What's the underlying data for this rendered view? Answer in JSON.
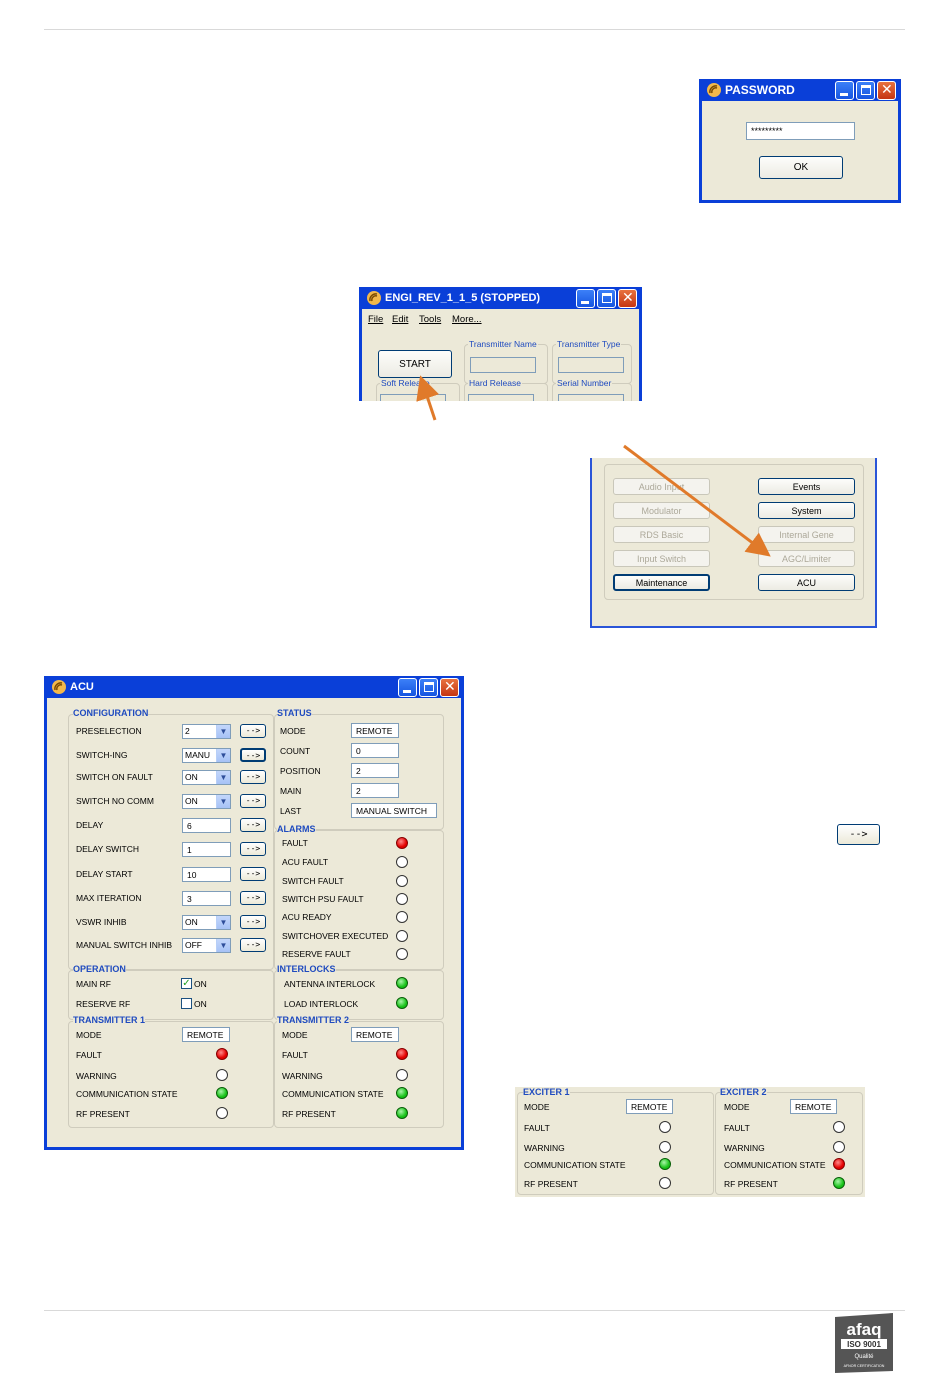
{
  "password_window": {
    "title": "PASSWORD",
    "password_value": "*********",
    "ok_label": "OK"
  },
  "engi_window": {
    "title": "ENGI_REV_1_1_5 (STOPPED)",
    "menu": [
      "File",
      "Edit",
      "Tools",
      "More..."
    ],
    "start_label": "START",
    "fields": [
      "Transmitter Name",
      "Transmitter Type",
      "Soft Release",
      "Hard Release",
      "Serial Number"
    ]
  },
  "panel": {
    "buttons_left": [
      "Audio Input",
      "Modulator",
      "RDS Basic",
      "Input Switch",
      "Maintenance"
    ],
    "buttons_right": [
      "Events",
      "System",
      "Internal Gene",
      "AGC/Limiter",
      "ACU"
    ],
    "enabled_left": [
      false,
      false,
      false,
      false,
      true
    ],
    "enabled_right": [
      true,
      true,
      false,
      false,
      true
    ]
  },
  "acu_window": {
    "title": "ACU",
    "configuration": {
      "title": "CONFIGURATION",
      "rows": [
        {
          "label": "PRESELECTION",
          "value": "2",
          "type": "select"
        },
        {
          "label": "SWITCH-ING",
          "value": "MANU",
          "type": "select"
        },
        {
          "label": "SWITCH ON FAULT",
          "value": "ON",
          "type": "select"
        },
        {
          "label": "SWITCH NO COMM",
          "value": "ON",
          "type": "select"
        },
        {
          "label": "DELAY",
          "value": "6",
          "type": "input"
        },
        {
          "label": "DELAY SWITCH",
          "value": "1",
          "type": "input"
        },
        {
          "label": "DELAY START",
          "value": "10",
          "type": "input"
        },
        {
          "label": "MAX ITERATION",
          "value": "3",
          "type": "input"
        },
        {
          "label": "VSWR INHIB",
          "value": "ON",
          "type": "select"
        },
        {
          "label": "MANUAL SWITCH INHIB",
          "value": "OFF",
          "type": "select"
        }
      ],
      "go_label": "-->"
    },
    "status": {
      "title": "STATUS",
      "rows": [
        {
          "label": "MODE",
          "value": "REMOTE"
        },
        {
          "label": "COUNT",
          "value": "0"
        },
        {
          "label": "POSITION",
          "value": "2"
        },
        {
          "label": "MAIN",
          "value": "2"
        },
        {
          "label": "LAST",
          "value": "MANUAL SWITCH"
        }
      ]
    },
    "alarms": {
      "title": "ALARMS",
      "rows": [
        {
          "label": "FAULT",
          "state": "red"
        },
        {
          "label": "ACU FAULT",
          "state": "off"
        },
        {
          "label": "SWITCH FAULT",
          "state": "off"
        },
        {
          "label": "SWITCH PSU FAULT",
          "state": "off"
        },
        {
          "label": "ACU READY",
          "state": "off"
        },
        {
          "label": "SWITCHOVER EXECUTED",
          "state": "off"
        },
        {
          "label": "RESERVE FAULT",
          "state": "off"
        }
      ]
    },
    "operation": {
      "title": "OPERATION",
      "rows": [
        {
          "label": "MAIN RF",
          "checked": true,
          "text": "ON"
        },
        {
          "label": "RESERVE RF",
          "checked": false,
          "text": "ON"
        }
      ]
    },
    "interlocks": {
      "title": "INTERLOCKS",
      "rows": [
        {
          "label": "ANTENNA INTERLOCK",
          "state": "green"
        },
        {
          "label": "LOAD INTERLOCK",
          "state": "green"
        }
      ]
    },
    "transmitter1": {
      "title": "TRANSMITTER 1",
      "mode_label": "MODE",
      "mode_value": "REMOTE",
      "rows": [
        {
          "label": "FAULT",
          "state": "red"
        },
        {
          "label": "WARNING",
          "state": "off"
        },
        {
          "label": "COMMUNICATION STATE",
          "state": "green"
        },
        {
          "label": "RF PRESENT",
          "state": "off"
        }
      ]
    },
    "transmitter2": {
      "title": "TRANSMITTER 2",
      "mode_label": "MODE",
      "mode_value": "REMOTE",
      "rows": [
        {
          "label": "FAULT",
          "state": "red"
        },
        {
          "label": "WARNING",
          "state": "off"
        },
        {
          "label": "COMMUNICATION STATE",
          "state": "green"
        },
        {
          "label": "RF PRESENT",
          "state": "green"
        }
      ]
    }
  },
  "arrow_button_label": "-->",
  "exciter1": {
    "title": "EXCITER 1",
    "mode_label": "MODE",
    "mode_value": "REMOTE",
    "rows": [
      {
        "label": "FAULT",
        "state": "off"
      },
      {
        "label": "WARNING",
        "state": "off"
      },
      {
        "label": "COMMUNICATION STATE",
        "state": "green"
      },
      {
        "label": "RF PRESENT",
        "state": "off"
      }
    ]
  },
  "exciter2": {
    "title": "EXCITER 2",
    "mode_label": "MODE",
    "mode_value": "REMOTE",
    "rows": [
      {
        "label": "FAULT",
        "state": "off"
      },
      {
        "label": "WARNING",
        "state": "off"
      },
      {
        "label": "COMMUNICATION STATE",
        "state": "red"
      },
      {
        "label": "RF PRESENT",
        "state": "green"
      }
    ]
  },
  "logo": {
    "brand": "afaq",
    "standard": "ISO 9001",
    "quality": "Qualité",
    "cert": "AFNOR CERTIFICATION"
  },
  "colors": {
    "xp_blue": "#0a3fd8",
    "panel_bg": "#ece9d8",
    "group_title": "#1f4bbf",
    "arrow": "#e07a2a",
    "led_red": "#e30000",
    "led_green": "#19c219"
  }
}
